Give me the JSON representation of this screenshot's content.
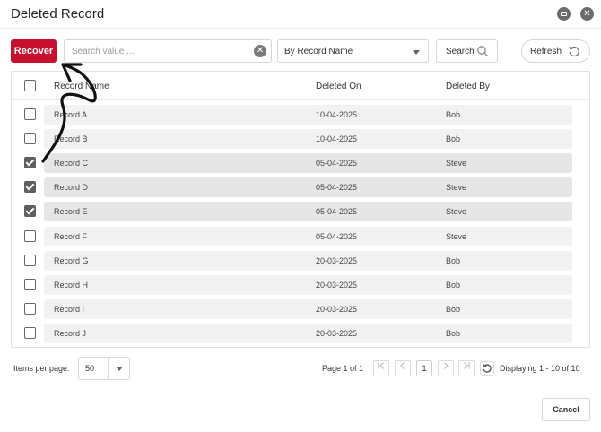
{
  "window": {
    "title": "Deleted Record"
  },
  "toolbar": {
    "recover_label": "Recover",
    "search_placeholder": "Search value ...",
    "search_value": "",
    "filter_selected": "By Record Name",
    "search_label": "Search",
    "refresh_label": "Refresh"
  },
  "table": {
    "columns": [
      "Record Name",
      "Deleted On",
      "Deleted By"
    ],
    "rows": [
      {
        "name": "Record A",
        "deleted_on": "10-04-2025",
        "deleted_by": "Bob",
        "checked": false
      },
      {
        "name": "Record B",
        "deleted_on": "10-04-2025",
        "deleted_by": "Bob",
        "checked": false
      },
      {
        "name": "Record C",
        "deleted_on": "05-04-2025",
        "deleted_by": "Steve",
        "checked": true
      },
      {
        "name": "Record D",
        "deleted_on": "05-04-2025",
        "deleted_by": "Steve",
        "checked": true
      },
      {
        "name": "Record E",
        "deleted_on": "05-04-2025",
        "deleted_by": "Steve",
        "checked": true
      },
      {
        "name": "Record F",
        "deleted_on": "05-04-2025",
        "deleted_by": "Steve",
        "checked": false
      },
      {
        "name": "Record G",
        "deleted_on": "20-03-2025",
        "deleted_by": "Bob",
        "checked": false
      },
      {
        "name": "Record H",
        "deleted_on": "20-03-2025",
        "deleted_by": "Bob",
        "checked": false
      },
      {
        "name": "Record I",
        "deleted_on": "20-03-2025",
        "deleted_by": "Bob",
        "checked": false
      },
      {
        "name": "Record J",
        "deleted_on": "20-03-2025",
        "deleted_by": "Bob",
        "checked": false
      }
    ]
  },
  "pagination": {
    "items_per_page_label": "Items per page:",
    "items_per_page": "50",
    "page_info": "Page 1 of 1",
    "current_page": "1",
    "display_info": "Displaying 1 - 10 of 10"
  },
  "footer": {
    "cancel_label": "Cancel"
  },
  "colors": {
    "accent": "#c8102e",
    "checkbox_checked": "#5f5f5f",
    "row_bg": "#f2f2f2"
  }
}
